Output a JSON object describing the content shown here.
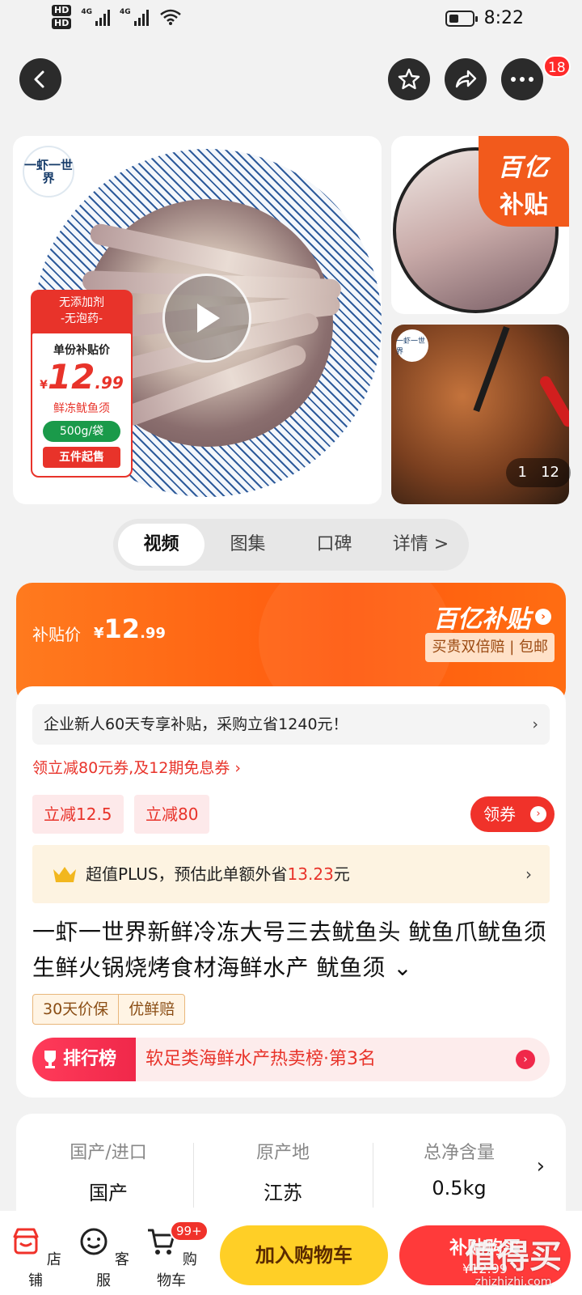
{
  "status_bar": {
    "hd_badges": [
      "HD",
      "HD"
    ],
    "sim_labels": [
      "4G",
      "4G"
    ],
    "time": "8:22",
    "battery_level": 0.4
  },
  "nav": {
    "back_icon": "back-arrow-icon",
    "favorite_icon": "star-icon",
    "share_icon": "share-icon",
    "more_icon": "more-dots-icon",
    "more_badge": "18"
  },
  "gallery": {
    "brand_logo_text": "一虾一世界",
    "promo_stamp": {
      "line1": "无添加剂",
      "line2": "-无泡药-"
    },
    "price_card": {
      "label": "单份补贴价",
      "currency": "¥",
      "integer": "12",
      "decimal": ".99",
      "name": "鲜冻鱿鱼须",
      "weight": "500g/袋",
      "min_order": "五件起售"
    },
    "subsidy_badge": {
      "line1": "百亿",
      "line2": "补贴"
    },
    "counter": {
      "current": "1",
      "total": "12"
    }
  },
  "media_tabs": {
    "items": [
      {
        "label": "视频",
        "active": true
      },
      {
        "label": "图集",
        "active": false
      },
      {
        "label": "口碑",
        "active": false
      },
      {
        "label": "详情 >",
        "active": false
      }
    ]
  },
  "price_banner": {
    "label": "补贴价",
    "currency": "¥",
    "integer": "12",
    "decimal": ".99",
    "brand": "百亿补贴",
    "guarantee": "买贵双倍赔 | 包邮"
  },
  "promo": {
    "new_user": "企业新人60天专享补贴，采购立省1240元！",
    "coupon_line": "领立减80元券,及12期免息券 ›",
    "tags": [
      "立减12.5",
      "立减80"
    ],
    "get_coupon": "领券",
    "plus_prefix": "超值PLUS，预估此单额外省",
    "plus_amount": "13.23",
    "plus_suffix": "元"
  },
  "product": {
    "title": "一虾一世界新鲜冷冻大号三去鱿鱼头 鱿鱼爪鱿鱼须生鲜火锅烧烤食材海鲜水产 鱿鱼须 ⌄",
    "service_tags": [
      "30天价保",
      "优鲜赔"
    ],
    "rank_badge": "排行榜",
    "rank_text": "软足类海鲜水产热卖榜·第3名"
  },
  "specs": [
    {
      "key": "国产/进口",
      "value": "国产"
    },
    {
      "key": "原产地",
      "value": "江苏"
    },
    {
      "key": "总净含量",
      "value": "0.5kg"
    }
  ],
  "bottom_bar": {
    "shop_label": "店铺",
    "service_label": "客服",
    "cart_label": "购物车",
    "cart_badge": "99+",
    "add_to_cart": "加入购物车",
    "buy_label": "补贴购买",
    "buy_price": "¥12.99"
  },
  "watermark": {
    "main": "值得买",
    "sub": "zhizhizhi.com"
  },
  "colors": {
    "accent_red": "#e8332a",
    "subsidy_orange": "#ff5a0e",
    "cart_yellow": "#ffcf26"
  }
}
